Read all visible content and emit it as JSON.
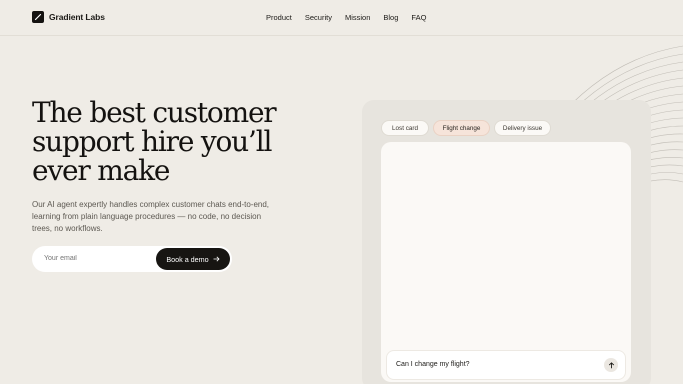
{
  "brand": {
    "name": "Gradient Labs",
    "logo_icon": "slash-logo-icon"
  },
  "nav": {
    "items": [
      "Product",
      "Security",
      "Mission",
      "Blog",
      "FAQ"
    ]
  },
  "hero": {
    "title_lines": [
      "The best customer",
      "support hire you’ll",
      "ever make"
    ],
    "subtitle": "Our AI agent expertly handles complex customer chats end-to-end, learning from plain language procedures — no code, no decision trees, no workflows.",
    "email_placeholder": "Your email",
    "cta_label": "Book a demo",
    "cta_icon": "arrow-right-icon"
  },
  "demo": {
    "chips": [
      {
        "label": "Lost card",
        "active": false
      },
      {
        "label": "Flight change",
        "active": true
      },
      {
        "label": "Delivery issue",
        "active": false
      }
    ],
    "message_input": "Can I change my flight?",
    "send_icon": "arrow-up-icon"
  },
  "colors": {
    "background": "#efece6",
    "dark": "#141210",
    "active_chip": "#f6e4da"
  }
}
